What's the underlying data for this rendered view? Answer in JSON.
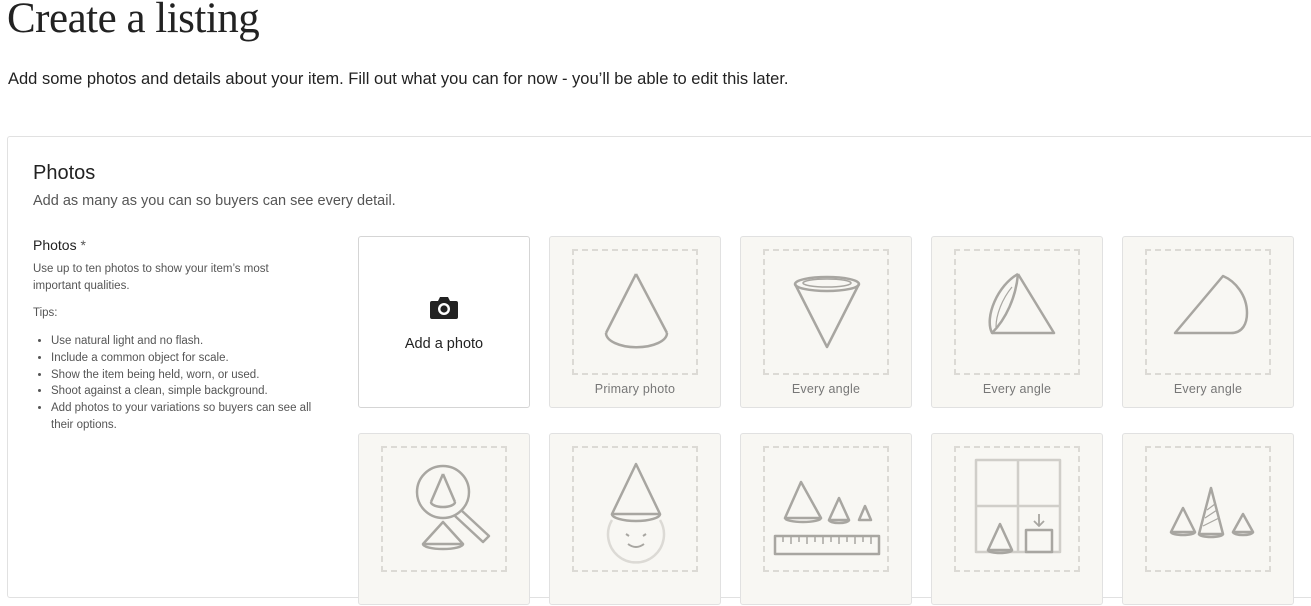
{
  "page": {
    "title": "Create a listing",
    "subtitle": "Add some photos and details about your item. Fill out what you can for now - you’ll be able to edit this later."
  },
  "photos_section": {
    "title": "Photos",
    "subtitle": "Add as many as you can so buyers can see every detail.",
    "field_label": "Photos",
    "required_mark": "*",
    "description": "Use up to ten photos to show your item’s most important qualities.",
    "tips_heading": "Tips:",
    "tips": [
      "Use natural light and no flash.",
      "Include a common object for scale.",
      "Show the item being held, worn, or used.",
      "Shoot against a clean, simple background.",
      "Add photos to your variations so buyers can see all their options."
    ],
    "add_photo_label": "Add a photo",
    "add_photo_icon": "camera-icon",
    "tiles": [
      {
        "caption": "Primary photo",
        "icon": "cone-front-icon"
      },
      {
        "caption": "Every angle",
        "icon": "cone-inverted-icon"
      },
      {
        "caption": "Every angle",
        "icon": "cone-side-icon"
      },
      {
        "caption": "Every angle",
        "icon": "cone-back-icon"
      },
      {
        "caption": "",
        "icon": "magnifier-detail-icon"
      },
      {
        "caption": "",
        "icon": "person-wearing-cone-icon"
      },
      {
        "caption": "",
        "icon": "cones-with-ruler-icon"
      },
      {
        "caption": "",
        "icon": "cone-in-room-icon"
      },
      {
        "caption": "",
        "icon": "cone-variations-icon"
      }
    ]
  },
  "colors": {
    "text": "#222222",
    "muted": "#555555",
    "tile_bg": "#f8f7f3",
    "dash": "#dcdad5",
    "art_stroke": "#a8a6a1"
  }
}
